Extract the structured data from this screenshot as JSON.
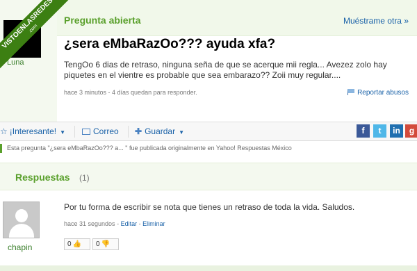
{
  "watermark": {
    "line1": "VISTOENLASREDES",
    "line2": ".com"
  },
  "question": {
    "status": "Pregunta abierta",
    "show_other": "Muéstrame otra »",
    "title": "¿sera eMbaRazOo??? ayuda xfa?",
    "body": "TengOo 6 dias de retraso, ninguna seña de que se acerque mii regla... Avezez zolo hay piquetes en el vientre es probable que sea embarazo?? Zoii muy regular....",
    "meta": "hace 3 minutos - 4 días quedan para responder.",
    "report": "Reportar abusos",
    "user": "Luna"
  },
  "actions": {
    "interesting": "¡Interesante!",
    "mail": "Correo",
    "save": "Guardar"
  },
  "social": {
    "facebook": "f",
    "twitter": "t",
    "linkedin": "in",
    "google": "g"
  },
  "origin_note": "Esta pregunta \"¿sera eMbaRazOo??? a... \" fue publicada originalmente en Yahoo! Respuestas México",
  "answers": {
    "title": "Respuestas",
    "count": "(1)",
    "items": [
      {
        "user": "chapin",
        "text": "Por tu forma de escribir se nota que tienes un retraso de toda la vida. Saludos.",
        "time": "hace 31 segundos",
        "edit": "Editar",
        "delete": "Eliminar",
        "up_votes": "0",
        "down_votes": "0"
      }
    ]
  },
  "colors": {
    "accent": "#5aa02c",
    "link": "#1a62a8",
    "ribbon": "#3c7f12"
  }
}
